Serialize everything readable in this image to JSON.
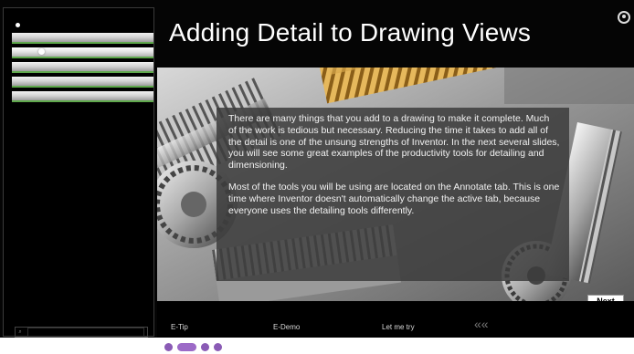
{
  "slide": {
    "title": "Adding Detail to Drawing Views"
  },
  "content": {
    "paragraph_1": "There are many things that you add to a drawing to make it complete. Much of the work is tedious but necessary. Reducing the time it takes to add all of the detail is one of the unsung strengths of Inventor. In the next several slides, you will see some great examples of the productivity tools for detailing and dimensioning.",
    "paragraph_2": "Most of the tools you will be using are located on the Annotate tab. This is one time where Inventor doesn't automatically change the active tab, because everyone uses the detailing tools differently."
  },
  "navigation": {
    "next_label": "Next",
    "bottom_links": [
      {
        "label": "E-Tip"
      },
      {
        "label": "E-Demo"
      },
      {
        "label": "Let me try"
      }
    ],
    "back_glyph": "««"
  },
  "sidebar": {
    "item_count": 6,
    "active_index": 1
  },
  "pager": {
    "dot_count": 4,
    "active_index": 1
  },
  "icons": {
    "back": "double-chevron-left-icon",
    "corner": "circle-icon",
    "footer": "search-icon"
  },
  "colors": {
    "background": "#050505",
    "text_box": "#3c3c3c",
    "nav_accent": "#5fa84c",
    "pager": "#8a5bb5"
  }
}
